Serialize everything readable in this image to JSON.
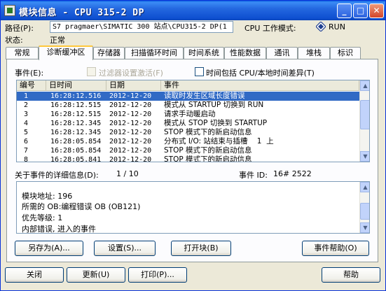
{
  "window": {
    "title": "模块信息 - CPU 315-2 DP",
    "controls": {
      "minimize": "_",
      "maximize": "□",
      "close": "✕"
    }
  },
  "header": {
    "path_label": "路径(P):",
    "path_value": "S7 pragmaer\\SIMATIC 300 站点\\CPU315-2 DP(1",
    "mode_label": "CPU 工作模式:",
    "mode_value": "RUN",
    "status_label": "状态:",
    "status_value": "正常"
  },
  "tabs": [
    {
      "label": "常规"
    },
    {
      "label": "诊断缓冲区"
    },
    {
      "label": "存储器"
    },
    {
      "label": "扫描循环时间"
    },
    {
      "label": "时间系统"
    },
    {
      "label": "性能数据"
    },
    {
      "label": "通讯"
    },
    {
      "label": "堆栈"
    },
    {
      "label": "标识"
    }
  ],
  "events": {
    "label": "事件(E):",
    "filter_label": "过滤器设置激活(F)",
    "time_diff_label": "时间包括 CPU/本地时间差异(T)",
    "columns": [
      "编号",
      "日时间",
      "日期",
      "事件"
    ],
    "rows": [
      {
        "no": "1",
        "time": "16:28:12.516",
        "date": "2012-12-20",
        "event": "读取时发生区域长度错误"
      },
      {
        "no": "2",
        "time": "16:28:12.515",
        "date": "2012-12-20",
        "event": "模式从 STARTUP 切换到 RUN"
      },
      {
        "no": "3",
        "time": "16:28:12.515",
        "date": "2012-12-20",
        "event": "请求手动暖启动"
      },
      {
        "no": "4",
        "time": "16:28:12.345",
        "date": "2012-12-20",
        "event": "模式从 STOP 切换到 STARTUP"
      },
      {
        "no": "5",
        "time": "16:28:12.345",
        "date": "2012-12-20",
        "event": "STOP 模式下的新启动信息"
      },
      {
        "no": "6",
        "time": "16:28:05.854",
        "date": "2012-12-20",
        "event": "分布式 I/O: 站结束与插槽    1  上"
      },
      {
        "no": "7",
        "time": "16:28:05.854",
        "date": "2012-12-20",
        "event": "STOP 模式下的新启动信息"
      },
      {
        "no": "8",
        "time": "16:28:05.841",
        "date": "2012-12-20",
        "event": "STOP 模式下的新启动信息"
      }
    ],
    "selected_index": 0
  },
  "details": {
    "label": "关于事件的详细信息(D):",
    "counter": "1 / 10",
    "event_id_label": "事件 ID:",
    "event_id_value": "16# 2522",
    "lines": [
      "模块地址:   196",
      "所需的 OB:编程错误 OB (OB121)",
      "优先等级: 1",
      "内部错误, 进入的事件"
    ]
  },
  "panel_buttons": {
    "save_as": "另存为(A)...",
    "settings": "设置(S)...",
    "open_block": "打开块(B)",
    "event_help": "事件帮助(O)"
  },
  "footer_buttons": {
    "close": "关闭",
    "update": "更新(U)",
    "print": "打印(P)...",
    "help": "帮助"
  },
  "colors": {
    "selection": "#316ac5",
    "titlebar": "#0a5fdf",
    "mode_icon": "#1f3f8f"
  }
}
